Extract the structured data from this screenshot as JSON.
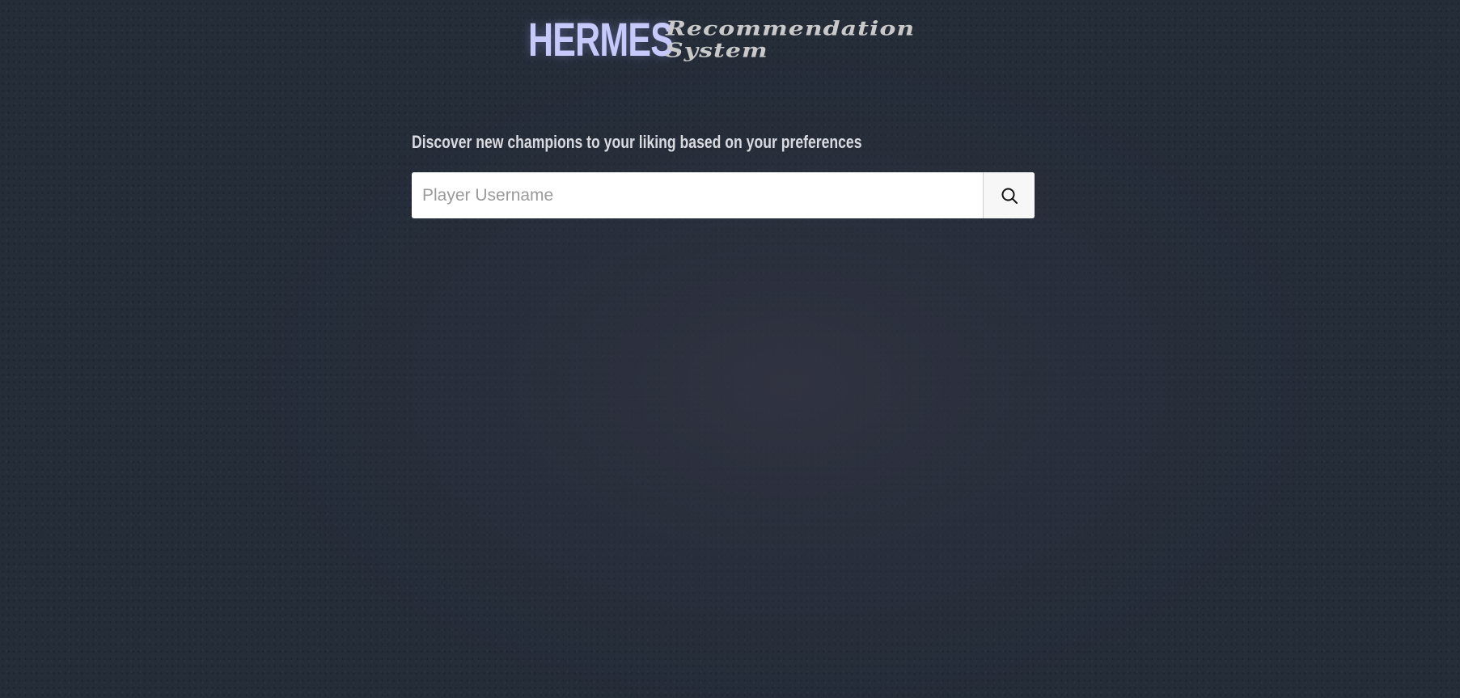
{
  "header": {
    "logo_main": "HERMES",
    "logo_sub_line1": "Recommendation",
    "logo_sub_line2": "System"
  },
  "main": {
    "tagline": "Discover new champions to your liking based on your preferences",
    "search": {
      "placeholder": "Player Username",
      "value": "",
      "button_icon": "search-icon"
    }
  },
  "colors": {
    "background": "#252d39",
    "logo_accent": "#c7c9fb",
    "logo_sub": "#c9c9c9",
    "tagline": "#d9dbe0"
  }
}
